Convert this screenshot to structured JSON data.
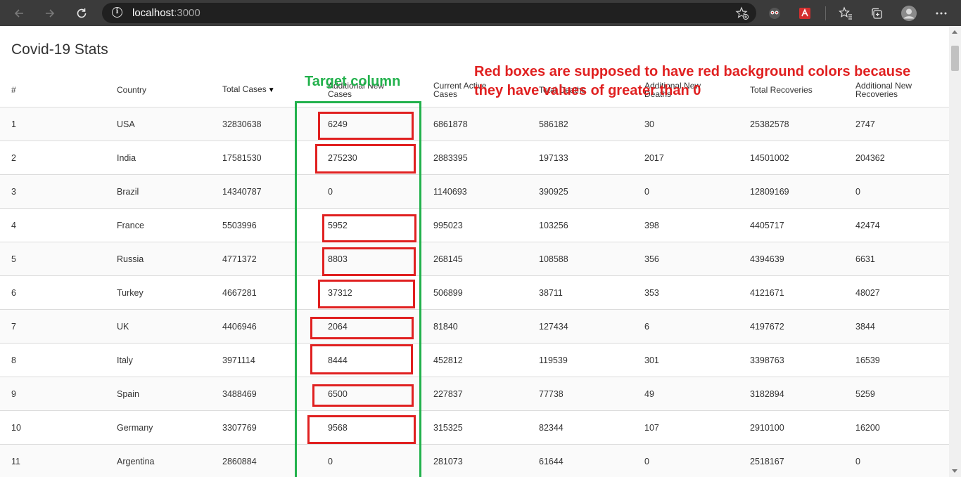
{
  "browser": {
    "url_host": "localhost",
    "url_port": ":3000"
  },
  "page": {
    "title": "Covid-19 Stats"
  },
  "annotations": {
    "green_label": "Target column",
    "red_label_line1": "Red boxes are supposed to have red background colors because",
    "red_label_line2": "they have values of greater than 0",
    "green_color": "#22b14c",
    "red_color": "#e02020"
  },
  "table": {
    "sort_indicator": "▼",
    "headers": {
      "num": "#",
      "country": "Country",
      "total_cases": "Total Cases",
      "new_cases_1": "Additional New",
      "new_cases_2": "Cases",
      "active_1": "Current Active",
      "active_2": "Cases",
      "deaths": "Total Deaths",
      "new_deaths_1": "Additional New",
      "new_deaths_2": "Deaths",
      "recoveries": "Total Recoveries",
      "new_rec_1": "Additional New",
      "new_rec_2": "Recoveries"
    },
    "rows": [
      {
        "num": "1",
        "country": "USA",
        "total": "32830638",
        "new_cases": "6249",
        "active": "6861878",
        "deaths": "586182",
        "new_deaths": "30",
        "recoveries": "25382578",
        "new_rec": "2747"
      },
      {
        "num": "2",
        "country": "India",
        "total": "17581530",
        "new_cases": "275230",
        "active": "2883395",
        "deaths": "197133",
        "new_deaths": "2017",
        "recoveries": "14501002",
        "new_rec": "204362"
      },
      {
        "num": "3",
        "country": "Brazil",
        "total": "14340787",
        "new_cases": "0",
        "active": "1140693",
        "deaths": "390925",
        "new_deaths": "0",
        "recoveries": "12809169",
        "new_rec": "0"
      },
      {
        "num": "4",
        "country": "France",
        "total": "5503996",
        "new_cases": "5952",
        "active": "995023",
        "deaths": "103256",
        "new_deaths": "398",
        "recoveries": "4405717",
        "new_rec": "42474"
      },
      {
        "num": "5",
        "country": "Russia",
        "total": "4771372",
        "new_cases": "8803",
        "active": "268145",
        "deaths": "108588",
        "new_deaths": "356",
        "recoveries": "4394639",
        "new_rec": "6631"
      },
      {
        "num": "6",
        "country": "Turkey",
        "total": "4667281",
        "new_cases": "37312",
        "active": "506899",
        "deaths": "38711",
        "new_deaths": "353",
        "recoveries": "4121671",
        "new_rec": "48027"
      },
      {
        "num": "7",
        "country": "UK",
        "total": "4406946",
        "new_cases": "2064",
        "active": "81840",
        "deaths": "127434",
        "new_deaths": "6",
        "recoveries": "4197672",
        "new_rec": "3844"
      },
      {
        "num": "8",
        "country": "Italy",
        "total": "3971114",
        "new_cases": "8444",
        "active": "452812",
        "deaths": "119539",
        "new_deaths": "301",
        "recoveries": "3398763",
        "new_rec": "16539"
      },
      {
        "num": "9",
        "country": "Spain",
        "total": "3488469",
        "new_cases": "6500",
        "active": "227837",
        "deaths": "77738",
        "new_deaths": "49",
        "recoveries": "3182894",
        "new_rec": "5259"
      },
      {
        "num": "10",
        "country": "Germany",
        "total": "3307769",
        "new_cases": "9568",
        "active": "315325",
        "deaths": "82344",
        "new_deaths": "107",
        "recoveries": "2910100",
        "new_rec": "16200"
      },
      {
        "num": "11",
        "country": "Argentina",
        "total": "2860884",
        "new_cases": "0",
        "active": "281073",
        "deaths": "61644",
        "new_deaths": "0",
        "recoveries": "2518167",
        "new_rec": "0"
      }
    ]
  }
}
